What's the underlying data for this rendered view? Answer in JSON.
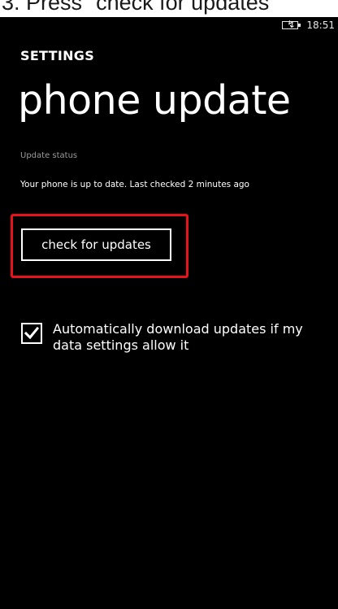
{
  "caption": "3. Press \"check for updates\"",
  "status_bar": {
    "battery_icon": "battery-charging-icon",
    "time": "18:51"
  },
  "header": {
    "section_label": "SETTINGS",
    "page_title": "phone update"
  },
  "update_status": {
    "heading": "Update status",
    "message": "Your phone is up to date. Last checked 2 minutes ago"
  },
  "check_button": {
    "label": "check for updates",
    "highlight_color": "#e8131a"
  },
  "auto_download": {
    "checked": true,
    "label": "Automatically download updates if my data settings allow it"
  },
  "colors": {
    "background": "#000000",
    "foreground": "#ffffff",
    "muted": "#9b9b9b"
  }
}
